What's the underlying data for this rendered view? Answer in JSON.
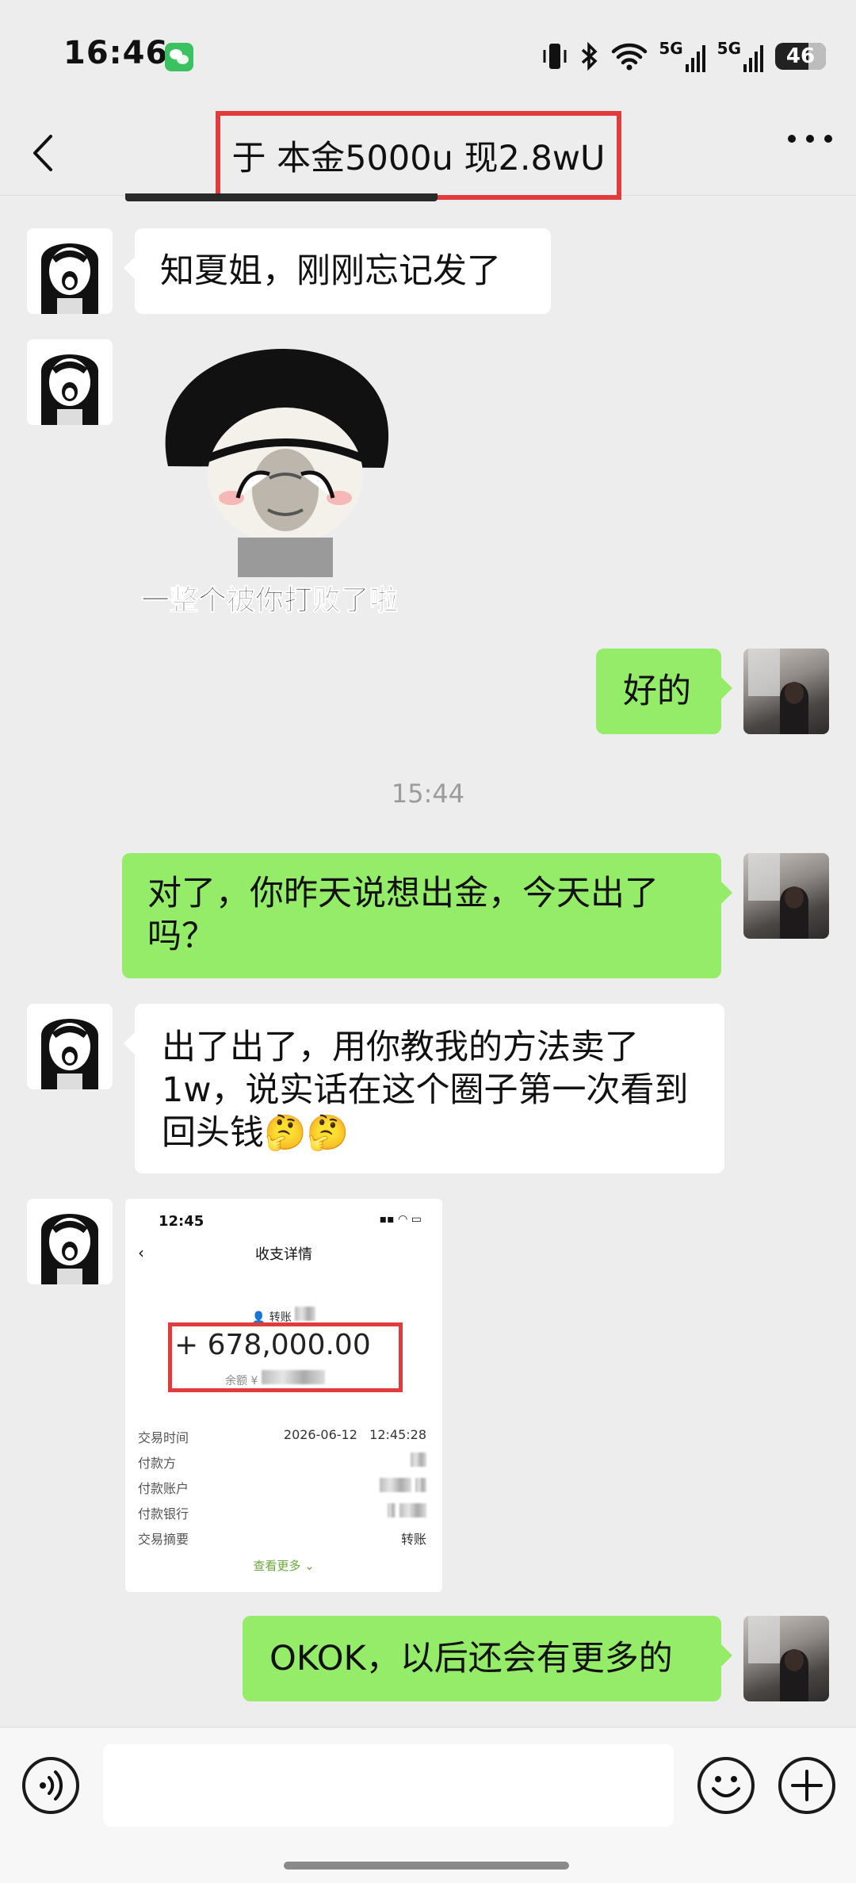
{
  "status_bar": {
    "time": "16:46",
    "network1": "5G",
    "network2": "5G",
    "battery": "46"
  },
  "header": {
    "title": "于 本金5000u 现2.8wU"
  },
  "messages": {
    "m1": "知夏姐，刚刚忘记发了",
    "sticker_caption": "一整个被你打败了啦",
    "m2": "好的",
    "timestamp": "15:44",
    "m3": "对了，你昨天说想出金，今天出了吗？",
    "m4": "出了出了，用你教我的方法卖了1w，说实话在这个圈子第一次看到回头钱🤔🤔",
    "m5": "OKOK，以后还会有更多的"
  },
  "receipt": {
    "time": "12:45",
    "title": "收支详情",
    "party": "转账",
    "amount": "+ 678,000.00",
    "balance_label": "余额 ¥",
    "rows": [
      {
        "label": "交易时间",
        "value": "2026-06-12   12:45:28"
      },
      {
        "label": "付款方",
        "value": ""
      },
      {
        "label": "付款账户",
        "value": ""
      },
      {
        "label": "付款银行",
        "value": ""
      },
      {
        "label": "交易摘要",
        "value": "转账"
      }
    ],
    "more": "查看更多"
  },
  "colors": {
    "bubble_green": "#95ec69",
    "highlight_red": "#e23b3b",
    "background": "#ededed"
  }
}
